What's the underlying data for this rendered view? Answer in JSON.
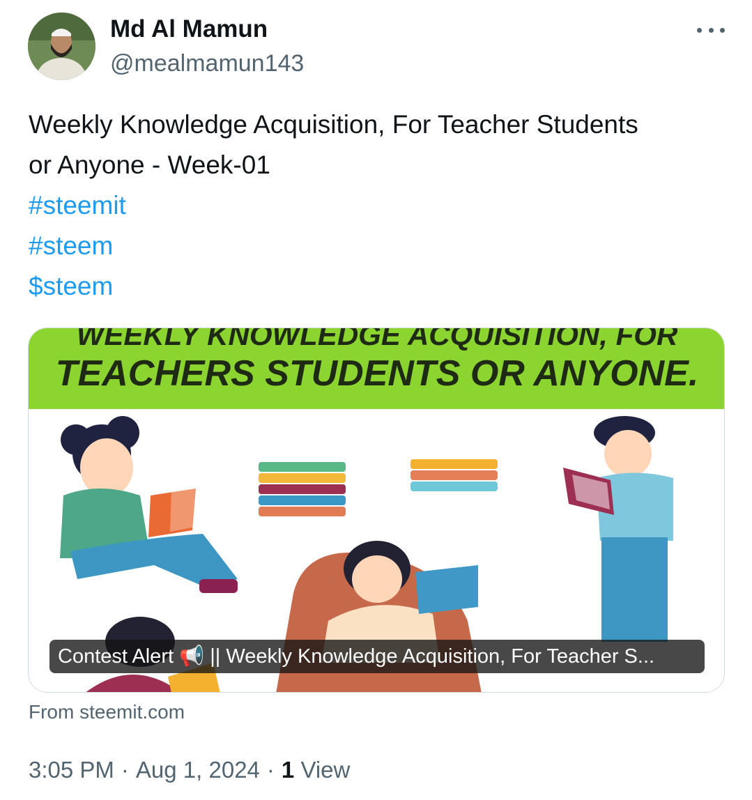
{
  "author": {
    "name": "Md Al Mamun",
    "handle": "@mealmamun143",
    "avatar_icon": "profile-photo"
  },
  "more_icon": "more-horizontal-icon",
  "tweet": {
    "text_line1": "Weekly Knowledge Acquisition, For Teacher Students",
    "text_line2": "or Anyone - Week-01",
    "hashtags": [
      "#steemit",
      "#steem",
      "$steem"
    ]
  },
  "card": {
    "banner_line1": "WEEKLY KNOWLEDGE ACQUISITION, FOR",
    "banner_line2": "TEACHERS STUDENTS OR ANYONE.",
    "caption": "Contest Alert 📢 || Weekly Knowledge Acquisition, For Teacher S...",
    "source": "From steemit.com",
    "banner_color": "#8cd531"
  },
  "meta": {
    "time": "3:05 PM",
    "date": "Aug 1, 2024",
    "views_count": "1",
    "views_label": "View"
  },
  "colors": {
    "link": "#1d9bf0",
    "secondary_text": "#536471",
    "primary_text": "#0f1419"
  }
}
